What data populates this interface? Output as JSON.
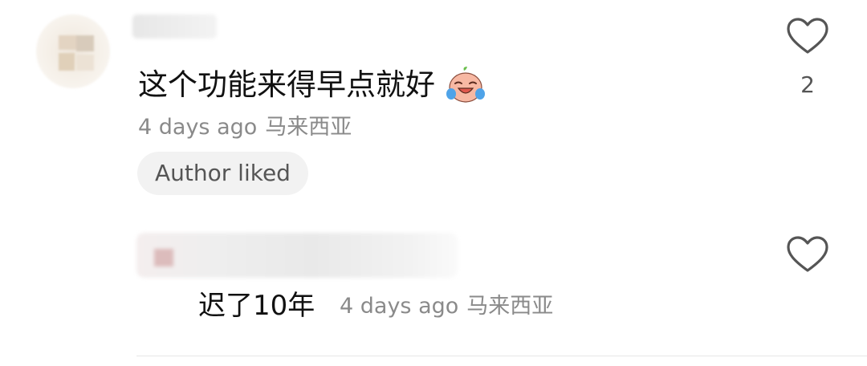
{
  "comment": {
    "text": "这个功能来得早点就好",
    "emoji_icon": "crying-laughing-face-icon",
    "time": "4 days ago",
    "location": "马来西亚",
    "author_liked_label": "Author liked",
    "like_count": "2"
  },
  "reply": {
    "text": "迟了10年",
    "time": "4 days ago",
    "location": "马来西亚"
  },
  "colors": {
    "text_primary": "#111111",
    "text_secondary": "#8a8a8a",
    "pill_bg": "#f2f2f2"
  }
}
